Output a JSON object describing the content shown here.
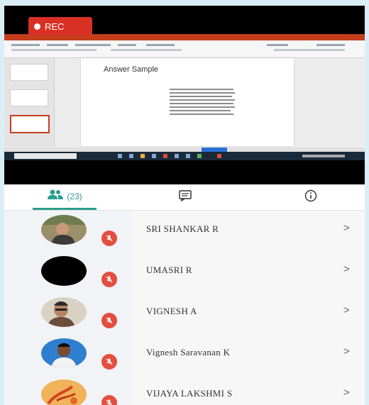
{
  "recording": {
    "label": "REC",
    "color": "#d93025"
  },
  "screen": {
    "slide_title": "Answer Sample",
    "app_accent": "#c43e1c"
  },
  "tabs": {
    "people_count": "(23)",
    "people_icon": "people-icon",
    "chat_icon": "chat-icon",
    "info_icon": "info-icon"
  },
  "participants": [
    {
      "name": "SRI SHANKAR R",
      "avatar": "photo",
      "muted": true
    },
    {
      "name": "UMASRI R",
      "avatar": "black",
      "muted": true
    },
    {
      "name": "VIGNESH A",
      "avatar": "photo",
      "muted": true
    },
    {
      "name": "Vignesh Saravanan K",
      "avatar": "photo",
      "muted": true
    },
    {
      "name": "VIJAYA LAKSHMI S",
      "avatar": "photo",
      "muted": true
    }
  ],
  "chevron": ">",
  "colors": {
    "accent": "#2a9d8f",
    "mic_muted": "#e34e3f"
  }
}
